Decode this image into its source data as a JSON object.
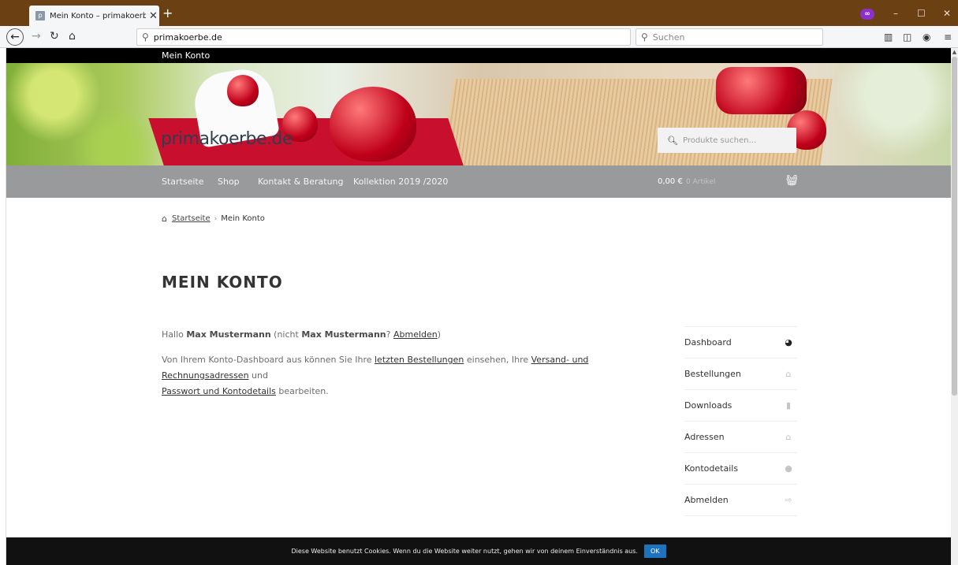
{
  "browser": {
    "tab_title": "Mein Konto – primakoerbe.de",
    "tab_favicon": "p",
    "tab_close": "✕",
    "new_tab": "+",
    "url": "primakoerbe.de",
    "search_placeholder": "Suchen",
    "private_mask": "∞",
    "window_minimize": "–",
    "window_maximize": "☐",
    "window_close": "✕"
  },
  "topbar": {
    "account_link": "Mein Konto"
  },
  "header": {
    "logo": "primakoerbe.de",
    "product_search_placeholder": "Produkte suchen…"
  },
  "nav": {
    "items": [
      "Startseite",
      "Shop",
      "Kontakt & Beratung",
      "Kollektion 2019 /2020"
    ],
    "cart_amount": "0,00 €",
    "cart_count": "0 Artikel"
  },
  "breadcrumb": {
    "home": "Startseite",
    "sep": "›",
    "current": "Mein Konto"
  },
  "page": {
    "title": "MEIN KONTO",
    "greeting_prefix": "Hallo ",
    "user_name": "Max Mustermann",
    "greeting_mid": " (nicht ",
    "user_name_2": "Max Mustermann",
    "greeting_q": "? ",
    "logout_link": "Abmelden",
    "greeting_end": ")",
    "dash_prefix": "Von Ihrem Konto-Dashboard aus können Sie Ihre ",
    "orders_link": "letzten Bestellungen",
    "dash_mid": " einsehen, Ihre ",
    "address_link": "Versand- und Rechnungsadressen",
    "dash_and": " und",
    "password_link": "Passwort und Kontodetails",
    "dash_end": " bearbeiten."
  },
  "account_nav": [
    {
      "label": "Dashboard",
      "icon": "dashboard-icon"
    },
    {
      "label": "Bestellungen",
      "icon": "basket-icon"
    },
    {
      "label": "Downloads",
      "icon": "file-icon"
    },
    {
      "label": "Adressen",
      "icon": "home-icon"
    },
    {
      "label": "Kontodetails",
      "icon": "user-icon"
    },
    {
      "label": "Abmelden",
      "icon": "sign-out-icon"
    }
  ],
  "cookie": {
    "text": "Diese Website benutzt Cookies. Wenn du die Website weiter nutzt, gehen wir von deinem Einverständnis aus.",
    "ok": "OK"
  },
  "colors": {
    "tabbar": "#6b4113",
    "mainnav": "#999a9b",
    "cookie_ok": "#1e73be",
    "private_mask": "#8c2fcc"
  }
}
